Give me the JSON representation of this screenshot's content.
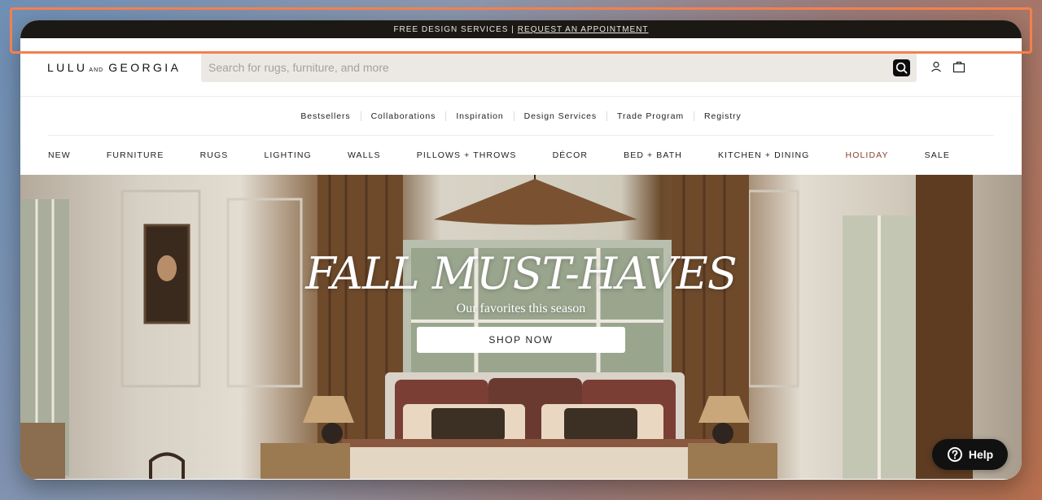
{
  "promo": {
    "text": "FREE DESIGN SERVICES |",
    "link": "REQUEST AN APPOINTMENT"
  },
  "header": {
    "logo": {
      "left": "LULU",
      "and": "AND",
      "right": "GEORGIA"
    },
    "search_placeholder": "Search for rugs, furniture, and more",
    "icons": [
      "search-icon",
      "account-icon",
      "bag-icon"
    ]
  },
  "secondary_nav": [
    "Bestsellers",
    "Collaborations",
    "Inspiration",
    "Design Services",
    "Trade Program",
    "Registry"
  ],
  "main_nav": [
    "NEW",
    "FURNITURE",
    "RUGS",
    "LIGHTING",
    "WALLS",
    "PILLOWS + THROWS",
    "DÉCOR",
    "BED + BATH",
    "KITCHEN + DINING",
    "HOLIDAY",
    "SALE"
  ],
  "hero": {
    "title": "FALL MUST-HAVES",
    "subtitle": "Our favorites this season",
    "cta": "SHOP NOW"
  },
  "help": {
    "label": "Help"
  },
  "colors": {
    "promo_bg": "#1c1915",
    "holiday": "#8a4332",
    "highlight": "#f2804e",
    "search_bg": "#ece9e5"
  }
}
